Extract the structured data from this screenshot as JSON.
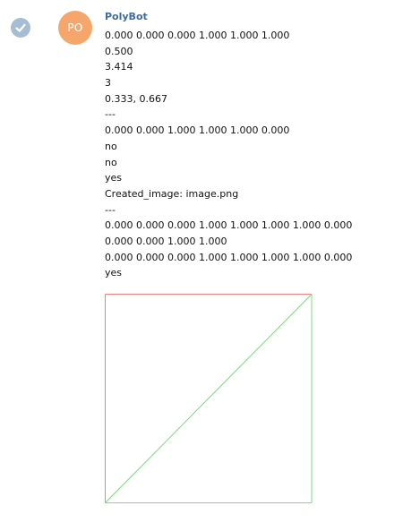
{
  "message": {
    "avatar_initials": "PO",
    "sender": "PolyBot",
    "lines": [
      "0.000 0.000 0.000 1.000 1.000 1.000",
      "0.500",
      "3.414",
      "3",
      "0.333, 0.667",
      "---",
      "0.000 0.000 1.000 1.000 1.000 0.000",
      "no",
      "no",
      "yes",
      "Created_image: image.png",
      "---",
      "0.000 0.000 0.000 1.000 1.000 1.000 1.000 0.000",
      "0.000 0.000 1.000 1.000",
      "0.000 0.000 0.000 1.000 1.000 1.000 1.000 0.000",
      "yes"
    ]
  },
  "colors": {
    "avatar": "#f7a66b",
    "sender": "#3d6c9e",
    "check_badge": "#a7bdd3",
    "red_stroke": "#f08080",
    "green_stroke": "#7ddb7d"
  },
  "icons": {
    "status": "check-circle-icon"
  }
}
